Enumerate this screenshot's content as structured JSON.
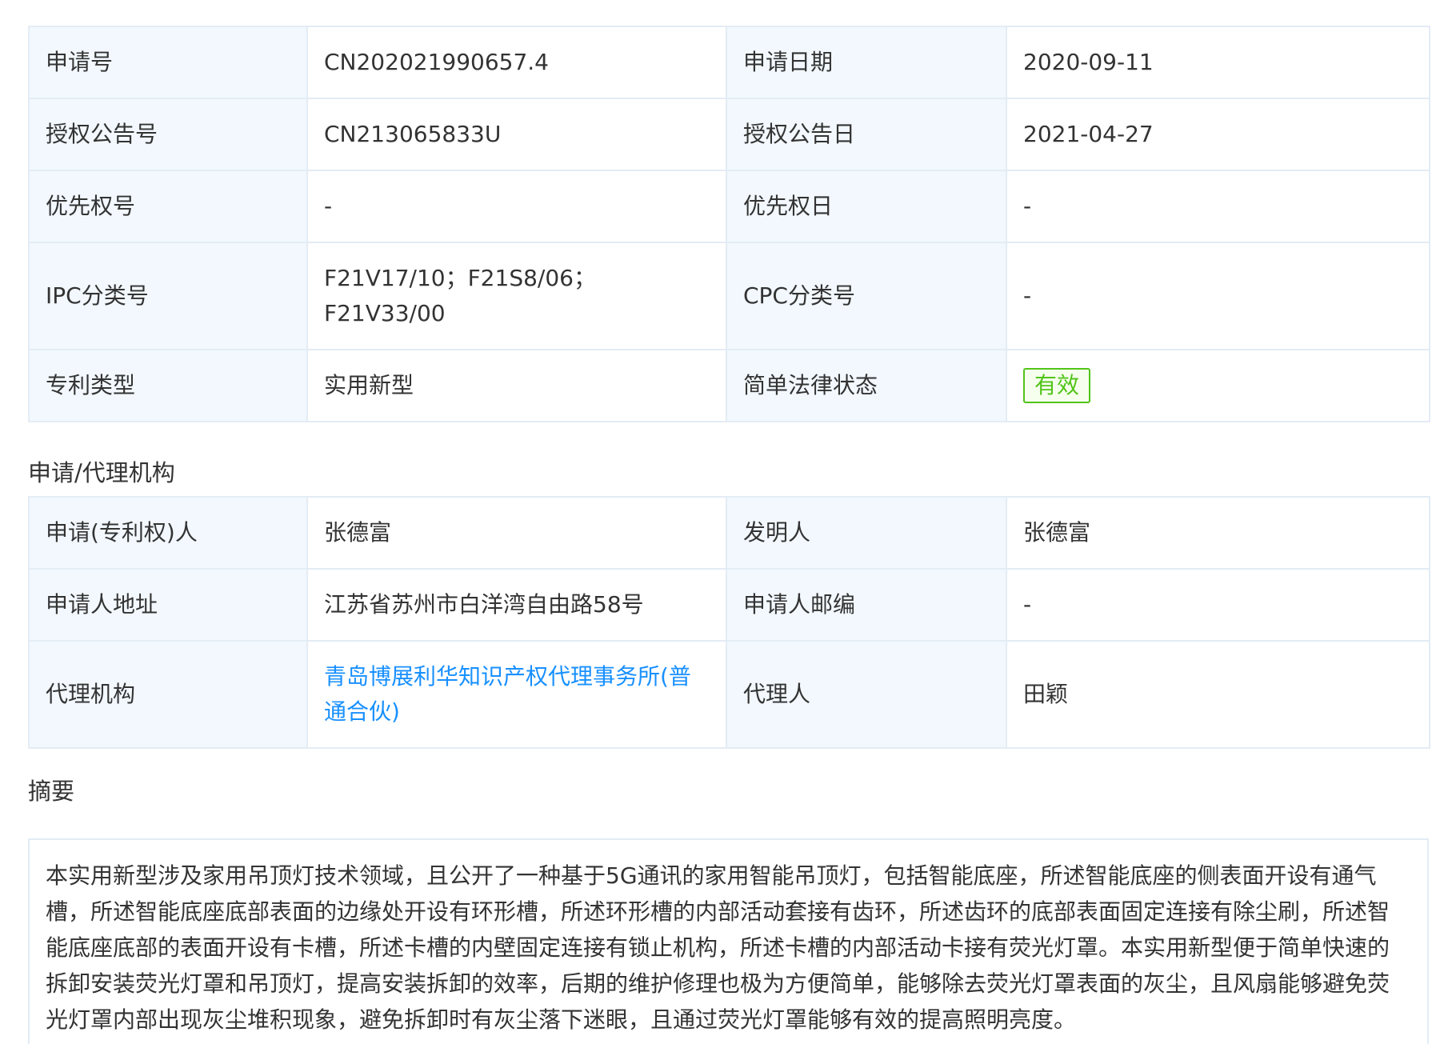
{
  "sections": {
    "agency_title": "申请/代理机构",
    "abstract_title": "摘要"
  },
  "basic_info": {
    "rows": [
      {
        "l1": "申请号",
        "v1": "CN202021990657.4",
        "l2": "申请日期",
        "v2": "2020-09-11"
      },
      {
        "l1": "授权公告号",
        "v1": "CN213065833U",
        "l2": "授权公告日",
        "v2": "2021-04-27"
      },
      {
        "l1": "优先权号",
        "v1": "-",
        "l2": "优先权日",
        "v2": "-"
      },
      {
        "l1": "IPC分类号",
        "v1": "F21V17/10；F21S8/06；F21V33/00",
        "l2": "CPC分类号",
        "v2": "-"
      },
      {
        "l1": "专利类型",
        "v1": "实用新型",
        "l2": "简单法律状态",
        "v2": "有效"
      }
    ]
  },
  "agency_info": {
    "rows": [
      {
        "l1": "申请(专利权)人",
        "v1": "张德富",
        "l2": "发明人",
        "v2": "张德富"
      },
      {
        "l1": "申请人地址",
        "v1": "江苏省苏州市白洋湾自由路58号",
        "l2": "申请人邮编",
        "v2": "-"
      },
      {
        "l1": "代理机构",
        "v1": "青岛博展利华知识产权代理事务所(普通合伙)",
        "l2": "代理人",
        "v2": "田颖"
      }
    ]
  },
  "abstract": {
    "text": "本实用新型涉及家用吊顶灯技术领域，且公开了一种基于5G通讯的家用智能吊顶灯，包括智能底座，所述智能底座的侧表面开设有通气槽，所述智能底座底部表面的边缘处开设有环形槽，所述环形槽的内部活动套接有齿环，所述齿环的底部表面固定连接有除尘刷，所述智能底座底部的表面开设有卡槽，所述卡槽的内壁固定连接有锁止机构，所述卡槽的内部活动卡接有荧光灯罩。本实用新型便于简单快速的拆卸安装荧光灯罩和吊顶灯，提高安装拆卸的效率，后期的维护修理也极为方便简单，能够除去荧光灯罩表面的灰尘，且风扇能够避免荧光灯罩内部出现灰尘堆积现象，避免拆卸时有灰尘落下迷眼，且通过荧光灯罩能够有效的提高照明亮度。"
  },
  "colors": {
    "label_bg": "#f2f8fe",
    "border": "#e4ecf5",
    "link": "#1890ff",
    "status_green": "#52c41a"
  }
}
